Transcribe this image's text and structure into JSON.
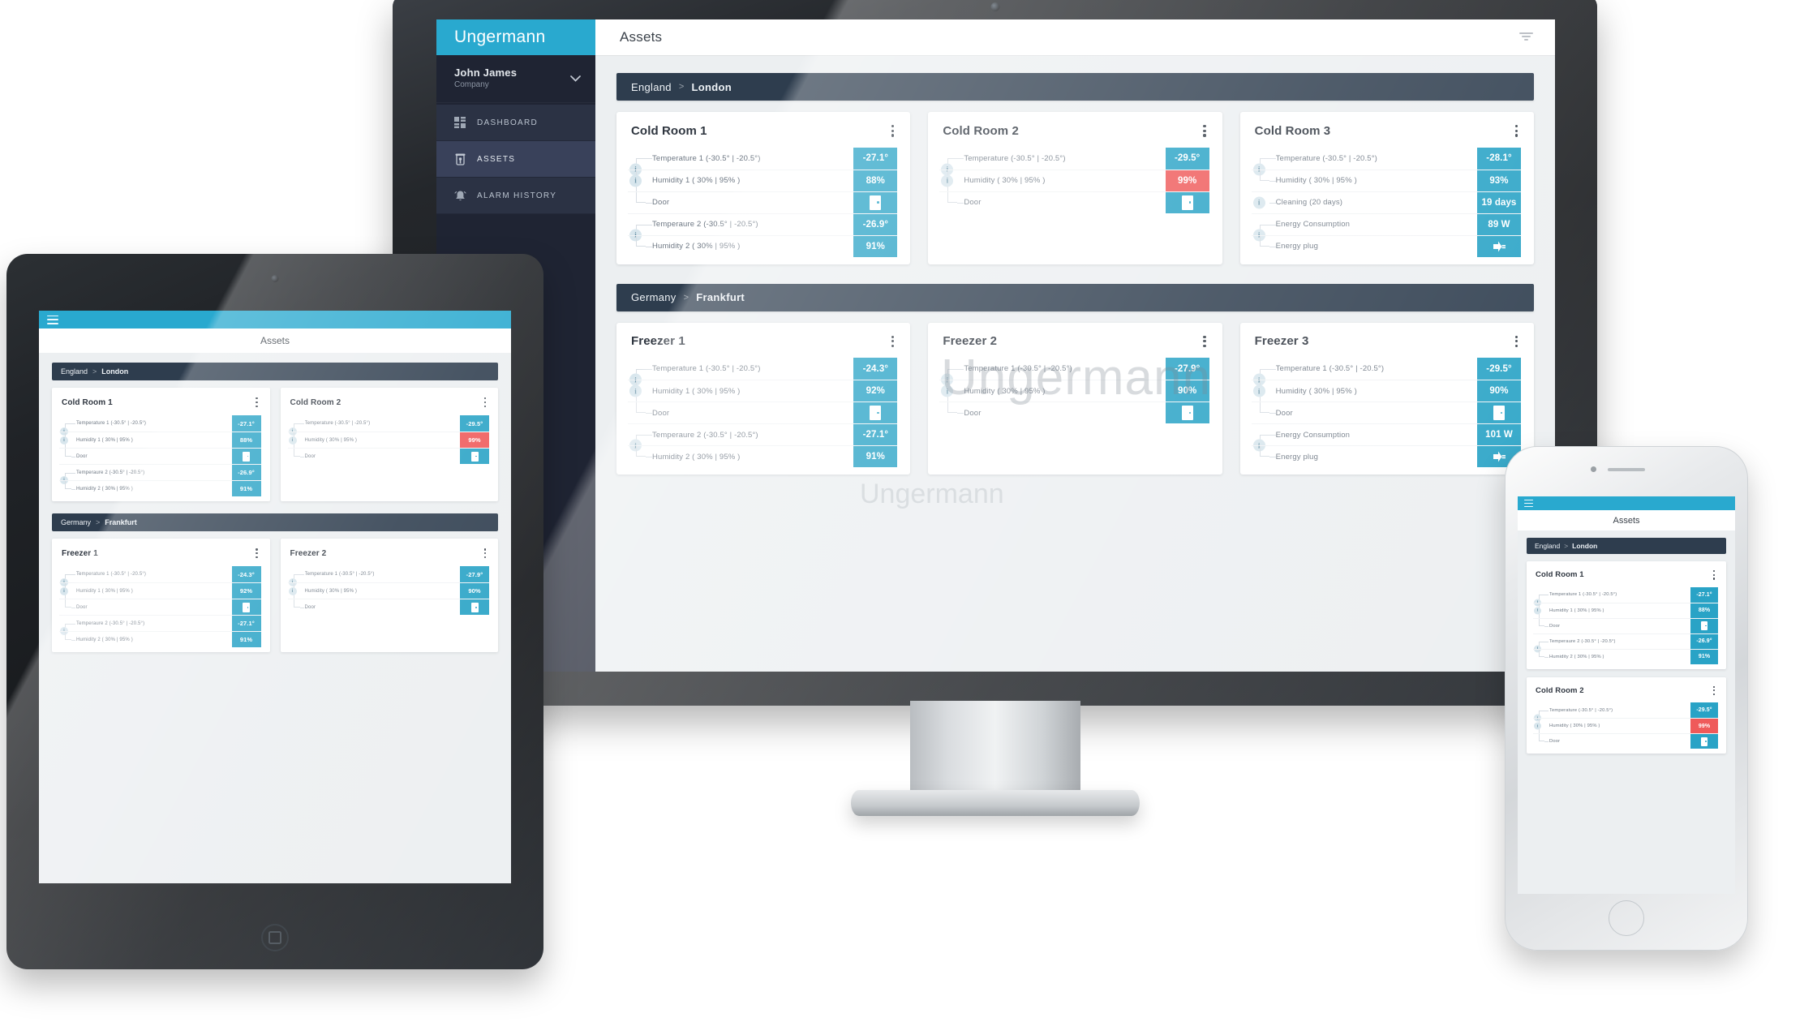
{
  "brand": {
    "name": "Ungermann",
    "accent": "#29a9cf",
    "alert": "#ef5a5a",
    "dark": "#2e3d4e"
  },
  "sidebar": {
    "user": {
      "name": "John James",
      "company": "Company"
    },
    "items": [
      {
        "label": "DASHBOARD",
        "icon": "grid-icon",
        "active": false
      },
      {
        "label": "ASSETS",
        "icon": "asset-icon",
        "active": true
      },
      {
        "label": "ALARM HISTORY",
        "icon": "alarm-bell-icon",
        "active": false
      }
    ]
  },
  "topbar": {
    "title": "Assets",
    "filter_icon": "funnel-icon"
  },
  "watermark": {
    "big": "Ungermann",
    "mid": "Ungermann"
  },
  "sections": [
    {
      "country": "England",
      "city": "London",
      "separator": ">",
      "cards": [
        {
          "title": "Cold Room 1",
          "rows": [
            {
              "label": "Temperature 1 (-30.5° | -20.5°)",
              "value": "-27.1°",
              "state": "ok",
              "glyph": "text",
              "group": 1,
              "gpos": "first"
            },
            {
              "label": "Humidity 1 ( 30% | 95% )",
              "value": "88%",
              "state": "ok",
              "glyph": "text",
              "group": 1,
              "gpos": "mid"
            },
            {
              "label": "Door",
              "value": "",
              "state": "ok",
              "glyph": "door",
              "group": 1,
              "gpos": "last"
            },
            {
              "label": "Temperaure 2 (-30.5° | -20.5°)",
              "value": "-26.9°",
              "state": "ok",
              "glyph": "text",
              "group": 2,
              "gpos": "first"
            },
            {
              "label": "Humidity 2 ( 30% | 95% )",
              "value": "91%",
              "state": "ok",
              "glyph": "text",
              "group": 2,
              "gpos": "last"
            }
          ]
        },
        {
          "title": "Cold Room 2",
          "rows": [
            {
              "label": "Temperature (-30.5° | -20.5°)",
              "value": "-29.5°",
              "state": "ok",
              "glyph": "text",
              "group": 1,
              "gpos": "first"
            },
            {
              "label": "Humidity ( 30% | 95% )",
              "value": "99%",
              "state": "alert",
              "glyph": "text",
              "group": 1,
              "gpos": "mid"
            },
            {
              "label": "Door",
              "value": "",
              "state": "ok",
              "glyph": "door",
              "group": 1,
              "gpos": "last"
            }
          ]
        },
        {
          "title": "Cold Room 3",
          "rows": [
            {
              "label": "Temperature (-30.5° | -20.5°)",
              "value": "-28.1°",
              "state": "ok",
              "glyph": "text",
              "group": 1,
              "gpos": "first"
            },
            {
              "label": "Humidity ( 30% | 95% )",
              "value": "93%",
              "state": "ok",
              "glyph": "text",
              "group": 1,
              "gpos": "last"
            },
            {
              "label": "Cleaning (20 days)",
              "value": "19 days",
              "state": "ok",
              "glyph": "text",
              "group": 2,
              "gpos": "solo"
            },
            {
              "label": "Energy Consumption",
              "value": "89 W",
              "state": "ok",
              "glyph": "text",
              "group": 3,
              "gpos": "first"
            },
            {
              "label": "Energy plug",
              "value": "",
              "state": "ok",
              "glyph": "plug",
              "group": 3,
              "gpos": "last"
            }
          ]
        }
      ]
    },
    {
      "country": "Germany",
      "city": "Frankfurt",
      "separator": ">",
      "cards": [
        {
          "title": "Freezer 1",
          "rows": [
            {
              "label": "Temperature 1 (-30.5° | -20.5°)",
              "value": "-24.3°",
              "state": "ok",
              "glyph": "text",
              "group": 1,
              "gpos": "first"
            },
            {
              "label": "Humidity 1 ( 30% | 95% )",
              "value": "92%",
              "state": "ok",
              "glyph": "text",
              "group": 1,
              "gpos": "mid"
            },
            {
              "label": "Door",
              "value": "",
              "state": "ok",
              "glyph": "door",
              "group": 1,
              "gpos": "last"
            },
            {
              "label": "Temperaure 2 (-30.5° | -20.5°)",
              "value": "-27.1°",
              "state": "ok",
              "glyph": "text",
              "group": 2,
              "gpos": "first"
            },
            {
              "label": "Humidity 2 ( 30% | 95% )",
              "value": "91%",
              "state": "ok",
              "glyph": "text",
              "group": 2,
              "gpos": "last"
            }
          ]
        },
        {
          "title": "Freezer 2",
          "rows": [
            {
              "label": "Temperature 1 (-30.5° | -20.5°)",
              "value": "-27.9°",
              "state": "ok",
              "glyph": "text",
              "group": 1,
              "gpos": "first"
            },
            {
              "label": "Humidity ( 30% | 95% )",
              "value": "90%",
              "state": "ok",
              "glyph": "text",
              "group": 1,
              "gpos": "mid"
            },
            {
              "label": "Door",
              "value": "",
              "state": "ok",
              "glyph": "door",
              "group": 1,
              "gpos": "last"
            }
          ]
        },
        {
          "title": "Freezer 3",
          "rows": [
            {
              "label": "Temperature 1 (-30.5° | -20.5°)",
              "value": "-29.5°",
              "state": "ok",
              "glyph": "text",
              "group": 1,
              "gpos": "first"
            },
            {
              "label": "Humidity ( 30% | 95% )",
              "value": "90%",
              "state": "ok",
              "glyph": "text",
              "group": 1,
              "gpos": "mid"
            },
            {
              "label": "Door",
              "value": "",
              "state": "ok",
              "glyph": "door",
              "group": 1,
              "gpos": "last"
            },
            {
              "label": "Energy Consumption",
              "value": "101 W",
              "state": "ok",
              "glyph": "text",
              "group": 2,
              "gpos": "first"
            },
            {
              "label": "Energy plug",
              "value": "",
              "state": "ok",
              "glyph": "plug",
              "group": 2,
              "gpos": "last"
            }
          ]
        }
      ]
    }
  ],
  "tablet": {
    "title": "Assets",
    "sections": [
      {
        "country": "England",
        "city": "London",
        "separator": ">",
        "card_indices": [
          0,
          1
        ]
      },
      {
        "country": "Germany",
        "city": "Frankfurt",
        "separator": ">",
        "card_indices": [
          0,
          1
        ]
      }
    ]
  },
  "phone": {
    "title": "Assets",
    "section": {
      "country": "England",
      "city": "London",
      "separator": ">"
    },
    "card_indices": [
      0,
      1
    ]
  }
}
